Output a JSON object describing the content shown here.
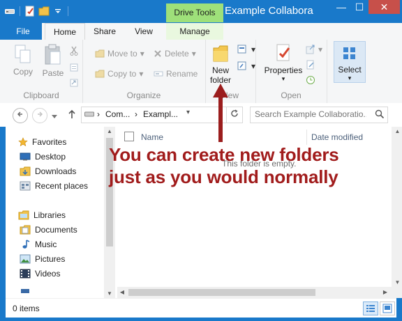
{
  "titlebar": {
    "title": "Example Collabora",
    "context_tab": "Drive Tools",
    "controls": {
      "minimize": "—",
      "maximize": "☐",
      "close": "✕"
    }
  },
  "ribbon_tabs": {
    "file": "File",
    "home": "Home",
    "share": "Share",
    "view": "View",
    "manage": "Manage",
    "expand_icon": "chevron-down",
    "help_icon": "help"
  },
  "ribbon": {
    "clipboard": {
      "label": "Clipboard",
      "copy": "Copy",
      "paste": "Paste"
    },
    "organize": {
      "label": "Organize",
      "move_to": "Move to",
      "copy_to": "Copy to",
      "delete": "Delete",
      "rename": "Rename"
    },
    "new": {
      "label": "New",
      "new_folder_line1": "New",
      "new_folder_line2": "folder"
    },
    "open": {
      "label": "Open",
      "properties": "Properties"
    },
    "select": {
      "select": "Select"
    }
  },
  "address": {
    "crumb1": "Com...",
    "crumb2": "Exampl...",
    "search_placeholder": "Search Example Collaboratio..."
  },
  "nav_pane": {
    "favorites": "Favorites",
    "desktop": "Desktop",
    "downloads": "Downloads",
    "recent": "Recent places",
    "libraries": "Libraries",
    "documents": "Documents",
    "music": "Music",
    "pictures": "Pictures",
    "videos": "Videos"
  },
  "file_pane": {
    "col_name": "Name",
    "col_date": "Date modified",
    "empty": "This folder is empty."
  },
  "status": {
    "items": "0 items"
  },
  "annotation": {
    "line1": "You can create new folders",
    "line2": "just as you would normally"
  },
  "colors": {
    "accent": "#1979ca",
    "context_tab": "#9ee07a",
    "close": "#c7504a",
    "annotation": "#a11c1c"
  }
}
